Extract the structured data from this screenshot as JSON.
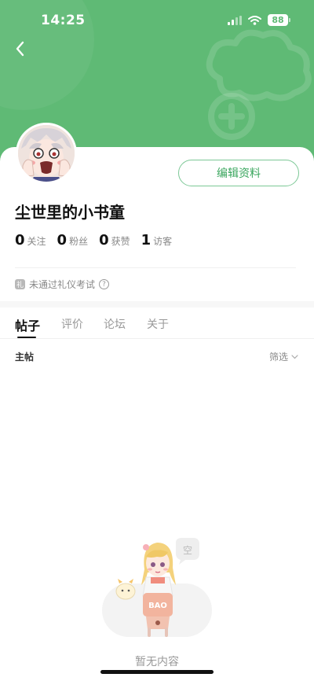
{
  "status_bar": {
    "time": "14:25",
    "battery": "88"
  },
  "profile": {
    "username": "尘世里的小书童",
    "edit_button": "编辑资料",
    "stats": [
      {
        "value": "0",
        "label": "关注"
      },
      {
        "value": "0",
        "label": "粉丝"
      },
      {
        "value": "0",
        "label": "获赞"
      },
      {
        "value": "1",
        "label": "访客"
      }
    ],
    "etiquette_badge": "礼",
    "etiquette_text": "未通过礼仪考试",
    "help_glyph": "?"
  },
  "tabs": [
    "帖子",
    "评价",
    "论坛",
    "关于"
  ],
  "active_tab": "帖子",
  "subheader": {
    "left": "主帖",
    "filter": "筛选"
  },
  "empty": {
    "bubble": "空",
    "sign": "BAO",
    "text": "暂无内容"
  },
  "colors": {
    "header_green": "#5fba75",
    "accent_green": "#3aa65e"
  }
}
